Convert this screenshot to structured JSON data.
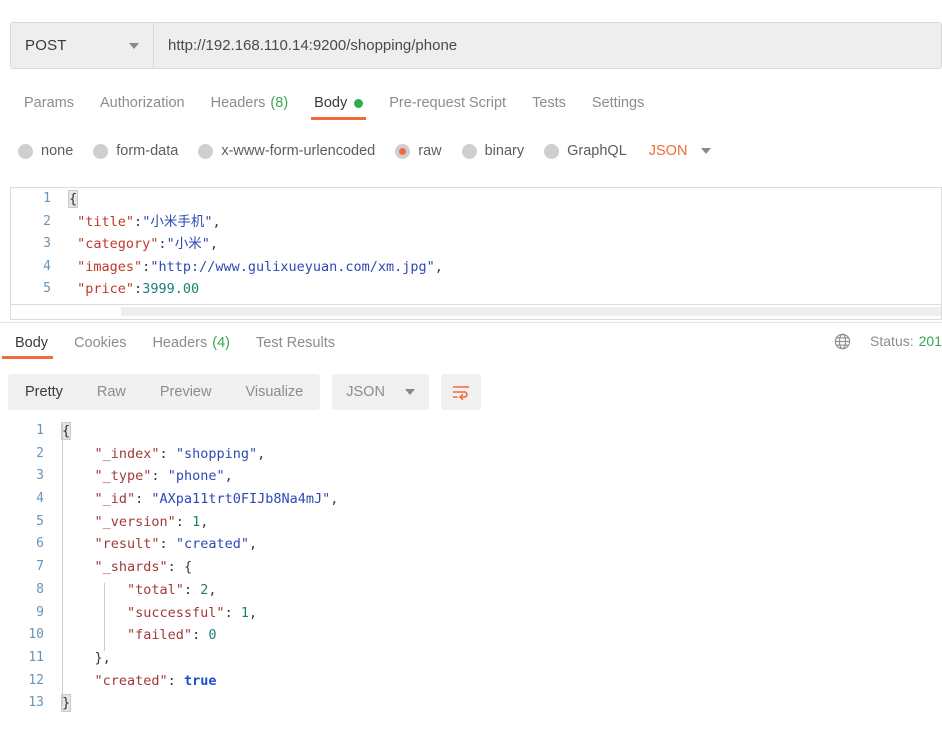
{
  "request": {
    "method": "POST",
    "url": "http://192.168.110.14:9200/shopping/phone",
    "tabs": [
      {
        "label": "Params",
        "count": null,
        "active": false,
        "dot": false
      },
      {
        "label": "Authorization",
        "count": null,
        "active": false,
        "dot": false
      },
      {
        "label": "Headers",
        "count": "(8)",
        "active": false,
        "dot": false
      },
      {
        "label": "Body",
        "count": null,
        "active": true,
        "dot": true
      },
      {
        "label": "Pre-request Script",
        "count": null,
        "active": false,
        "dot": false
      },
      {
        "label": "Tests",
        "count": null,
        "active": false,
        "dot": false
      },
      {
        "label": "Settings",
        "count": null,
        "active": false,
        "dot": false
      }
    ],
    "body_types": [
      {
        "label": "none",
        "selected": false
      },
      {
        "label": "form-data",
        "selected": false
      },
      {
        "label": "x-www-form-urlencoded",
        "selected": false
      },
      {
        "label": "raw",
        "selected": true
      },
      {
        "label": "binary",
        "selected": false
      },
      {
        "label": "GraphQL",
        "selected": false
      }
    ],
    "raw_format": "JSON",
    "body_lines": [
      {
        "n": "1",
        "tokens": [
          {
            "t": "{",
            "c": "brace-hl"
          }
        ]
      },
      {
        "n": "2",
        "tokens": [
          {
            "t": " ",
            "c": "punc"
          },
          {
            "t": "\"title\"",
            "c": "k-req"
          },
          {
            "t": ":",
            "c": "punc"
          },
          {
            "t": "\"小米手机\"",
            "c": "v-str"
          },
          {
            "t": ",",
            "c": "punc"
          }
        ]
      },
      {
        "n": "3",
        "tokens": [
          {
            "t": " ",
            "c": "punc"
          },
          {
            "t": "\"category\"",
            "c": "k-req"
          },
          {
            "t": ":",
            "c": "punc"
          },
          {
            "t": "\"小米\"",
            "c": "v-str"
          },
          {
            "t": ",",
            "c": "punc"
          }
        ]
      },
      {
        "n": "4",
        "tokens": [
          {
            "t": " ",
            "c": "punc"
          },
          {
            "t": "\"images\"",
            "c": "k-req"
          },
          {
            "t": ":",
            "c": "punc"
          },
          {
            "t": "\"http://www.gulixueyuan.com/xm.jpg\"",
            "c": "v-str"
          },
          {
            "t": ",",
            "c": "punc"
          }
        ]
      },
      {
        "n": "5",
        "tokens": [
          {
            "t": " ",
            "c": "punc"
          },
          {
            "t": "\"price\"",
            "c": "k-req"
          },
          {
            "t": ":",
            "c": "punc"
          },
          {
            "t": "3999.00",
            "c": "v-num"
          }
        ]
      }
    ]
  },
  "response": {
    "tabs": [
      {
        "label": "Body",
        "count": null,
        "active": true
      },
      {
        "label": "Cookies",
        "count": null,
        "active": false
      },
      {
        "label": "Headers",
        "count": "(4)",
        "active": false
      },
      {
        "label": "Test Results",
        "count": null,
        "active": false
      }
    ],
    "status_label": "Status:",
    "status_code": "201",
    "view_buttons": [
      {
        "label": "Pretty",
        "active": true
      },
      {
        "label": "Raw",
        "active": false
      },
      {
        "label": "Preview",
        "active": false
      },
      {
        "label": "Visualize",
        "active": false
      }
    ],
    "language": "JSON",
    "body_lines": [
      {
        "n": "1",
        "tokens": [
          {
            "t": "{",
            "c": "brace-hl"
          }
        ]
      },
      {
        "n": "2",
        "tokens": [
          {
            "t": "    ",
            "c": "punc"
          },
          {
            "t": "\"_index\"",
            "c": "k-res"
          },
          {
            "t": ": ",
            "c": "punc"
          },
          {
            "t": "\"shopping\"",
            "c": "v-res"
          },
          {
            "t": ",",
            "c": "punc"
          }
        ]
      },
      {
        "n": "3",
        "tokens": [
          {
            "t": "    ",
            "c": "punc"
          },
          {
            "t": "\"_type\"",
            "c": "k-res"
          },
          {
            "t": ": ",
            "c": "punc"
          },
          {
            "t": "\"phone\"",
            "c": "v-res"
          },
          {
            "t": ",",
            "c": "punc"
          }
        ]
      },
      {
        "n": "4",
        "tokens": [
          {
            "t": "    ",
            "c": "punc"
          },
          {
            "t": "\"_id\"",
            "c": "k-res"
          },
          {
            "t": ": ",
            "c": "punc"
          },
          {
            "t": "\"AXpa11trt0FIJb8Na4mJ\"",
            "c": "v-res"
          },
          {
            "t": ",",
            "c": "punc"
          }
        ]
      },
      {
        "n": "5",
        "tokens": [
          {
            "t": "    ",
            "c": "punc"
          },
          {
            "t": "\"_version\"",
            "c": "k-res"
          },
          {
            "t": ": ",
            "c": "punc"
          },
          {
            "t": "1",
            "c": "v-resnum"
          },
          {
            "t": ",",
            "c": "punc"
          }
        ]
      },
      {
        "n": "6",
        "tokens": [
          {
            "t": "    ",
            "c": "punc"
          },
          {
            "t": "\"result\"",
            "c": "k-res"
          },
          {
            "t": ": ",
            "c": "punc"
          },
          {
            "t": "\"created\"",
            "c": "v-res"
          },
          {
            "t": ",",
            "c": "punc"
          }
        ]
      },
      {
        "n": "7",
        "tokens": [
          {
            "t": "    ",
            "c": "punc"
          },
          {
            "t": "\"_shards\"",
            "c": "k-res"
          },
          {
            "t": ": ",
            "c": "punc"
          },
          {
            "t": "{",
            "c": "punc"
          }
        ]
      },
      {
        "n": "8",
        "tokens": [
          {
            "t": "        ",
            "c": "punc"
          },
          {
            "t": "\"total\"",
            "c": "k-res"
          },
          {
            "t": ": ",
            "c": "punc"
          },
          {
            "t": "2",
            "c": "v-resnum"
          },
          {
            "t": ",",
            "c": "punc"
          }
        ]
      },
      {
        "n": "9",
        "tokens": [
          {
            "t": "        ",
            "c": "punc"
          },
          {
            "t": "\"successful\"",
            "c": "k-res"
          },
          {
            "t": ": ",
            "c": "punc"
          },
          {
            "t": "1",
            "c": "v-resnum"
          },
          {
            "t": ",",
            "c": "punc"
          }
        ]
      },
      {
        "n": "10",
        "tokens": [
          {
            "t": "        ",
            "c": "punc"
          },
          {
            "t": "\"failed\"",
            "c": "k-res"
          },
          {
            "t": ": ",
            "c": "punc"
          },
          {
            "t": "0",
            "c": "v-resnum"
          }
        ]
      },
      {
        "n": "11",
        "tokens": [
          {
            "t": "    ",
            "c": "punc"
          },
          {
            "t": "},",
            "c": "punc"
          }
        ]
      },
      {
        "n": "12",
        "tokens": [
          {
            "t": "    ",
            "c": "punc"
          },
          {
            "t": "\"created\"",
            "c": "k-res"
          },
          {
            "t": ": ",
            "c": "punc"
          },
          {
            "t": "true",
            "c": "v-bool"
          }
        ]
      },
      {
        "n": "13",
        "tokens": [
          {
            "t": "}",
            "c": "brace-hl"
          }
        ]
      }
    ]
  },
  "icons": {
    "method_caret": "chevron-down-icon",
    "json_caret": "chevron-down-icon",
    "globe": "globe-icon",
    "wrap": "wrap-lines-icon"
  },
  "colors": {
    "accent": "#f26b3a",
    "success": "#2eab4f",
    "key_request": "#c0392b",
    "key_response": "#a03a3a",
    "string": "#2f49b5",
    "number": "#1b7f74",
    "gutter": "#6a93b8"
  }
}
